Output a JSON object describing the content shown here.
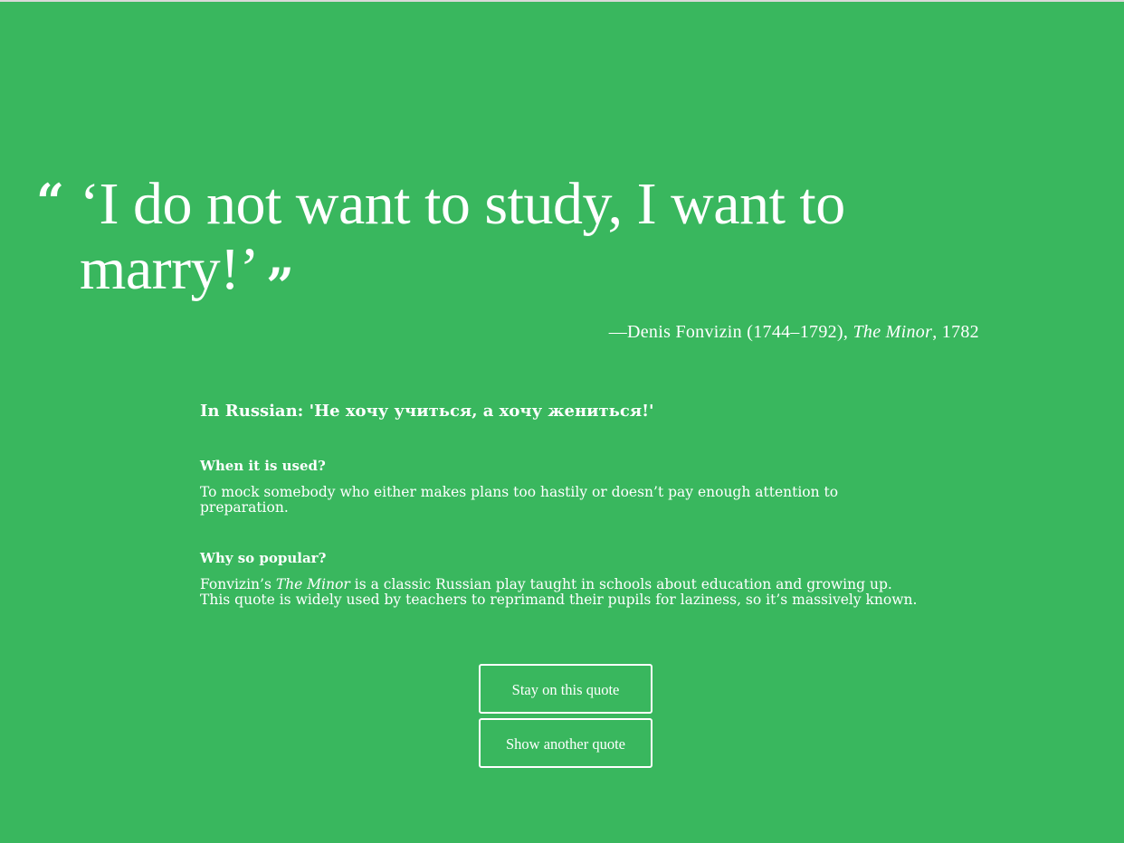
{
  "quote": {
    "open_mark": "“",
    "text": "‘I do not want to study, I want to marry!’",
    "close_mark": "”",
    "attribution_prefix": "—Denis Fonvizin (1744–1792), ",
    "attribution_work": "The Minor",
    "attribution_suffix": ", 1782"
  },
  "details": {
    "russian": "In Russian: 'Не хочу учиться, а хочу жениться!'",
    "when_title": "When it is used?",
    "when_text": "To mock somebody who either makes plans too hastily or doesn’t pay enough attention to preparation.",
    "why_title": "Why so popular?",
    "why_text_prefix": "Fonvizin’s ",
    "why_text_work": "The Minor",
    "why_text_suffix": " is a classic Russian play taught in schools about education and growing up. This quote is widely used by teachers to reprimand their pupils for laziness, so it’s massively known."
  },
  "buttons": {
    "stay": "Stay on this quote",
    "another": "Show another quote"
  },
  "colors": {
    "background": "#39b75e",
    "text": "#ffffff"
  }
}
